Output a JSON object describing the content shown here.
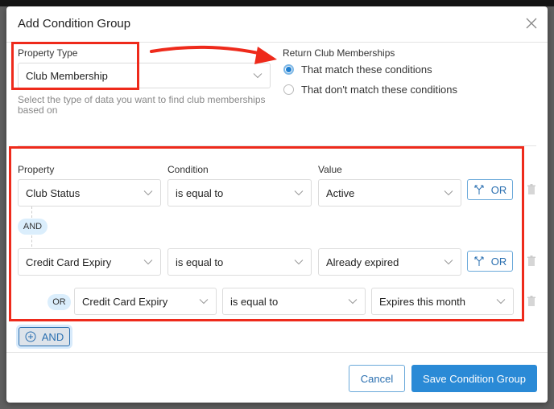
{
  "modal": {
    "title": "Add Condition Group",
    "close_icon": "close-icon"
  },
  "property_type": {
    "label": "Property Type",
    "value": "Club Membership",
    "help": "Select the type of data you want to find club memberships based on"
  },
  "return": {
    "label": "Return Club Memberships",
    "options": [
      {
        "label": "That match these conditions",
        "selected": true
      },
      {
        "label": "That don't match these conditions",
        "selected": false
      }
    ]
  },
  "conditions": {
    "headers": {
      "property": "Property",
      "condition": "Condition",
      "value": "Value"
    },
    "rows": [
      {
        "property": "Club Status",
        "condition": "is equal to",
        "value": "Active",
        "or_label": "OR"
      },
      {
        "property": "Credit Card Expiry",
        "condition": "is equal to",
        "value": "Already expired",
        "or_label": "OR"
      },
      {
        "prefix": "OR",
        "property": "Credit Card Expiry",
        "condition": "is equal to",
        "value": "Expires this month"
      }
    ],
    "and_connector": "AND"
  },
  "add_and_label": "AND",
  "footer": {
    "cancel": "Cancel",
    "save": "Save Condition Group"
  },
  "colors": {
    "accent": "#2a8ad6",
    "annotation": "#ee2a1b"
  }
}
